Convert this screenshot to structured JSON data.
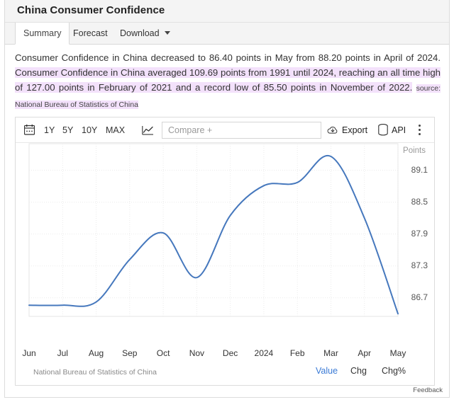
{
  "header": {
    "title": "China Consumer Confidence"
  },
  "tabs": [
    {
      "label": "Summary",
      "active": true
    },
    {
      "label": "Forecast",
      "active": false
    },
    {
      "label": "Download",
      "active": false,
      "has_caret": true
    }
  ],
  "description": {
    "lead": "Consumer Confidence in China decreased to 86.40 points in May from 88.20 points in April of 2024.",
    "highlight": "Consumer Confidence in China averaged 109.69 points from 1991 until 2024, reaching an all time high of 127.00 points in February of 2021 and a record low of 85.50 points in November of 2022.",
    "source": "source: National Bureau of Statistics of China"
  },
  "toolbar": {
    "calendar_icon": "calendar-icon",
    "ranges": [
      "1Y",
      "5Y",
      "10Y",
      "MAX"
    ],
    "chart_type_icon": "line-chart-icon",
    "compare_placeholder": "Compare +",
    "compare_value": "",
    "export_label": "Export",
    "export_icon": "cloud-download-icon",
    "api_label": "API",
    "api_icon": "database-icon",
    "more_icon": "vertical-dots-icon"
  },
  "chart_footer": {
    "source": "National Bureau of Statistics of China",
    "toggles": [
      {
        "label": "Value",
        "active": true
      },
      {
        "label": "Chg",
        "active": false
      },
      {
        "label": "Chg%",
        "active": false
      }
    ]
  },
  "feedback": {
    "label": "Feedback"
  },
  "colors": {
    "line": "#4678bd",
    "accent": "#3a7ad6",
    "highlight_bg": "#f3e1fb",
    "panel_border": "#dcdcdc",
    "grid": "#ebebeb"
  },
  "chart_data": {
    "type": "line",
    "title": "",
    "xlabel": "",
    "ylabel": "Points",
    "unit_label": "Points",
    "categories": [
      "Jun",
      "Jul",
      "Aug",
      "Sep",
      "Oct",
      "Nov",
      "Dec",
      "2024",
      "Feb",
      "Mar",
      "Apr",
      "May"
    ],
    "x_tick_labels": [
      "Jun",
      "Jul",
      "Aug",
      "Sep",
      "Oct",
      "Nov",
      "Dec",
      "2024",
      "Feb",
      "Mar",
      "Apr",
      "May"
    ],
    "y_tick_labels": [
      "89.1",
      "88.5",
      "87.9",
      "87.3",
      "86.7"
    ],
    "y_ticks": [
      89.1,
      88.5,
      87.9,
      87.3,
      86.7
    ],
    "ylim": [
      86.35,
      89.6
    ],
    "grid": true,
    "legend": null,
    "series": [
      {
        "name": "Consumer Confidence",
        "color": "#4678bd",
        "values": [
          86.56,
          86.56,
          86.62,
          87.42,
          87.92,
          87.08,
          88.25,
          88.81,
          88.87,
          89.36,
          88.2,
          86.4
        ]
      }
    ],
    "annotations": {
      "latest_value": 86.4,
      "latest_period": "May 2024",
      "previous_value": 88.2,
      "previous_period": "April 2024"
    }
  }
}
